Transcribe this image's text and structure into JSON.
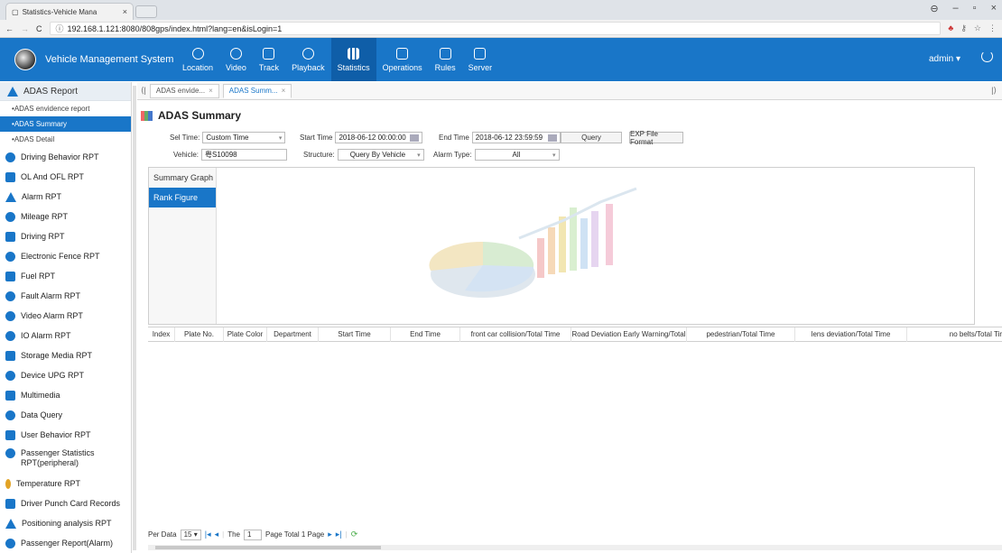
{
  "browser": {
    "tab_title": "Statistics-Vehicle Mana",
    "tab_close": "×",
    "url": "192.168.1.121:8080/808gps/index.html?lang=en&isLogin=1",
    "win_controls": [
      "⊖",
      "–",
      "▫",
      "×"
    ]
  },
  "app": {
    "name": "Vehicle Management System",
    "nav": [
      {
        "label": "Location",
        "icon": "location-pin-icon"
      },
      {
        "label": "Video",
        "icon": "play-circle-icon"
      },
      {
        "label": "Track",
        "icon": "track-icon"
      },
      {
        "label": "Playback",
        "icon": "playback-icon"
      },
      {
        "label": "Statistics",
        "icon": "bar-chart-icon",
        "active": true
      },
      {
        "label": "Operations",
        "icon": "operations-icon"
      },
      {
        "label": "Rules",
        "icon": "rules-icon"
      },
      {
        "label": "Server",
        "icon": "server-icon"
      }
    ],
    "user": "admin ▾",
    "accent": "#1976c8"
  },
  "sidebar": {
    "header": "ADAS Report",
    "subitems": [
      {
        "label": "ADAS envidence report"
      },
      {
        "label": "ADAS Summary",
        "active": true
      },
      {
        "label": "ADAS Detail"
      }
    ],
    "items": [
      {
        "label": "Driving Behavior RPT",
        "icon": "driving-behavior-icon"
      },
      {
        "label": "OL And OFL RPT",
        "icon": "ol-ofl-icon"
      },
      {
        "label": "Alarm RPT",
        "icon": "alarm-icon"
      },
      {
        "label": "Mileage RPT",
        "icon": "mileage-icon"
      },
      {
        "label": "Driving RPT",
        "icon": "driving-icon"
      },
      {
        "label": "Electronic Fence RPT",
        "icon": "fence-icon"
      },
      {
        "label": "Fuel RPT",
        "icon": "fuel-icon"
      },
      {
        "label": "Fault Alarm RPT",
        "icon": "fault-icon"
      },
      {
        "label": "Video Alarm RPT",
        "icon": "video-alarm-icon"
      },
      {
        "label": "IO Alarm RPT",
        "icon": "io-alarm-icon"
      },
      {
        "label": "Storage Media RPT",
        "icon": "storage-icon"
      },
      {
        "label": "Device UPG RPT",
        "icon": "upgrade-icon"
      },
      {
        "label": "Multimedia",
        "icon": "multimedia-icon"
      },
      {
        "label": "Data Query",
        "icon": "data-query-icon"
      },
      {
        "label": "User Behavior RPT",
        "icon": "user-behavior-icon"
      },
      {
        "label": "Passenger Statistics RPT(peripheral)",
        "icon": "passenger-icon"
      },
      {
        "label": "Temperature RPT",
        "icon": "temperature-icon"
      },
      {
        "label": "Driver Punch Card Records",
        "icon": "punch-card-icon"
      },
      {
        "label": "Positioning analysis RPT",
        "icon": "positioning-icon"
      },
      {
        "label": "Passenger Report(Alarm)",
        "icon": "passenger-alarm-icon"
      }
    ]
  },
  "tabs": [
    "ADAS envide...",
    "ADAS Summ..."
  ],
  "page_title": "ADAS Summary",
  "form": {
    "sel_time_label": "Sel Time:",
    "sel_time_value": "Custom Time",
    "start_label": "Start Time",
    "start_value": "2018-06-12 00:00:00",
    "end_label": "End Time",
    "end_value": "2018-06-12 23:59:59",
    "query_btn": "Query",
    "export_btn": "EXP File Format",
    "vehicle_label": "Vehicle:",
    "vehicle_value": "粤S10098",
    "structure_label": "Structure:",
    "structure_value": "Query By Vehicle",
    "alarm_label": "Alarm Type:",
    "alarm_value": "All"
  },
  "chart_tabs": [
    "Summary Graph",
    "Rank Figure"
  ],
  "table": {
    "columns": [
      "Index",
      "Plate No.",
      "Plate Color",
      "Department",
      "Start Time",
      "End Time",
      "front car collision/Total Time",
      "Road Deviation Early Warning/Total",
      "pedestrian/Total Time",
      "lens deviation/Total Time",
      "no belts/Total Tir"
    ]
  },
  "pager": {
    "per_data_label": "Per Data",
    "per_data_value": "15",
    "the_label": "The",
    "page_value": "1",
    "total_label": "Page  Total 1 Page"
  }
}
